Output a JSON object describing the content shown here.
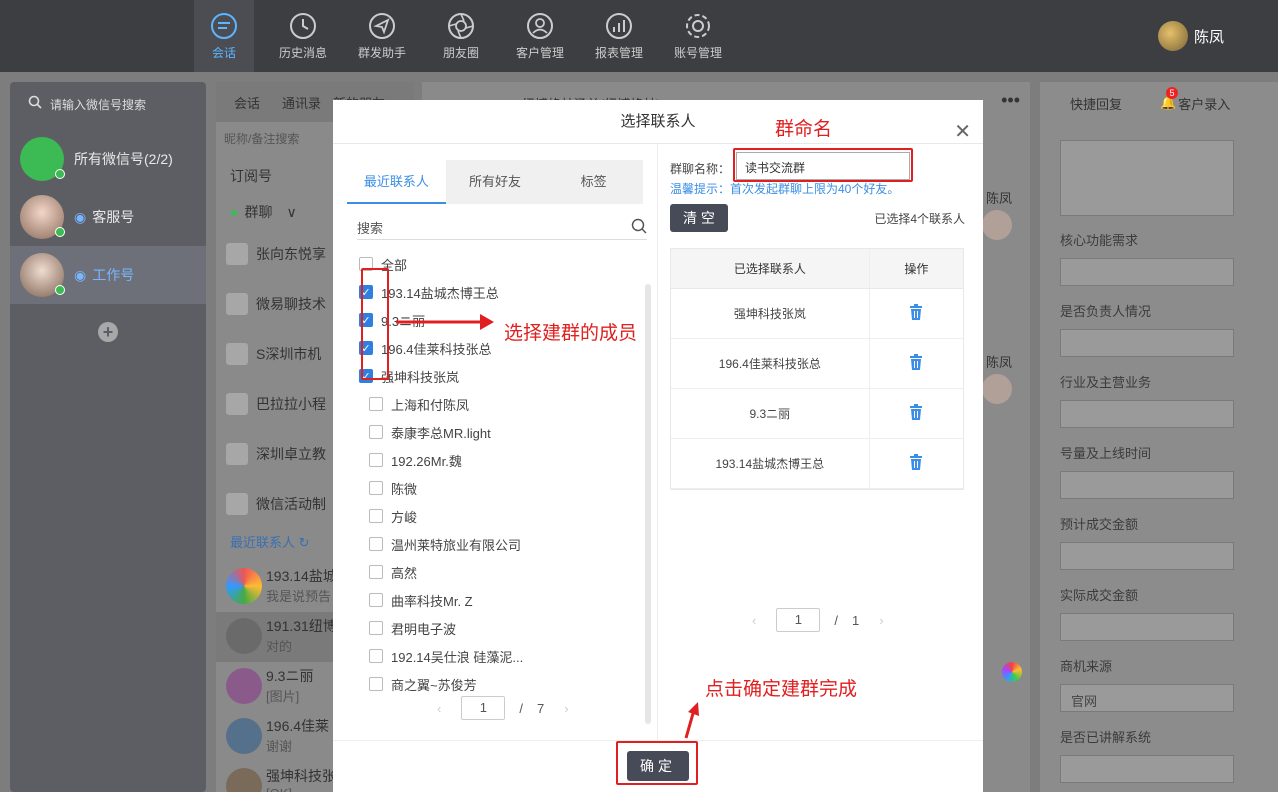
{
  "topnav": [
    {
      "label": "会话",
      "icon": "chat-icon",
      "active": true
    },
    {
      "label": "历史消息",
      "icon": "clock-icon"
    },
    {
      "label": "群发助手",
      "icon": "send-icon"
    },
    {
      "label": "朋友圈",
      "icon": "aperture-icon"
    },
    {
      "label": "客户管理",
      "icon": "person-icon"
    },
    {
      "label": "报表管理",
      "icon": "chart-icon"
    },
    {
      "label": "账号管理",
      "icon": "gear-icon"
    }
  ],
  "user": {
    "name": "陈凤"
  },
  "sidebar": {
    "search_placeholder": "请输入微信号搜索",
    "accounts": [
      {
        "label": "所有微信号(2/2)"
      },
      {
        "label": "客服号"
      },
      {
        "label": "工作号"
      }
    ]
  },
  "middle": {
    "tab_conv": "会话",
    "tab_contacts": "通讯录",
    "tab_new": "新的朋友",
    "search_placeholder": "昵称/备注搜索",
    "subscriptions": "订阅号",
    "groups_header": "群聊",
    "groups": [
      "张向东悦享",
      "微易聊技术",
      "S深圳市机",
      "巴拉拉小程",
      "深圳卓立教",
      "微信活动制"
    ],
    "recent_header": "最近联系人",
    "recent": [
      {
        "name": "193.14盐城",
        "preview": "我是说预告"
      },
      {
        "name": "191.31纽博",
        "preview": "对的"
      },
      {
        "name": "9.3ニ丽",
        "preview": "[图片]"
      },
      {
        "name": "196.4佳莱",
        "preview": "谢谢"
      },
      {
        "name": "强坤科技张",
        "preview": "[OK]"
      }
    ]
  },
  "conversation": {
    "title": "191.31纽博格林汤单(纽博格林)",
    "names": [
      "陈凤",
      "陈凤"
    ]
  },
  "right_panel": {
    "tab_quick": "快捷回复",
    "tab_customer": "客户录入",
    "badge": "5",
    "fields": [
      "核心功能需求",
      "是否负责人情况",
      "行业及主营业务",
      "号量及上线时间",
      "预计成交金额",
      "实际成交金额",
      "商机来源",
      "是否已讲解系统"
    ],
    "source_value": "官网"
  },
  "modal": {
    "title": "选择联系人",
    "tabs": [
      "最近联系人",
      "所有好友",
      "标签"
    ],
    "search_placeholder": "搜索",
    "all_label": "全部",
    "contacts": [
      {
        "name": "193.14盐城杰博王总",
        "checked": true
      },
      {
        "name": "9.3ニ丽",
        "checked": true
      },
      {
        "name": "196.4佳莱科技张总",
        "checked": true
      },
      {
        "name": "强坤科技张岚",
        "checked": true
      },
      {
        "name": "上海和付陈凤",
        "checked": false
      },
      {
        "name": "泰康李总MR.light",
        "checked": false
      },
      {
        "name": "192.26Mr.魏",
        "checked": false
      },
      {
        "name": "陈微",
        "checked": false
      },
      {
        "name": "方峻",
        "checked": false
      },
      {
        "name": "温州莱特旅业有限公司",
        "checked": false
      },
      {
        "name": "高然",
        "checked": false
      },
      {
        "name": "曲率科技Mr. Z",
        "checked": false
      },
      {
        "name": "君明电子波",
        "checked": false
      },
      {
        "name": "192.14吴仕浪 硅藻泥...",
        "checked": false
      },
      {
        "name": "商之翼~苏俊芳",
        "checked": false
      }
    ],
    "left_page": "1",
    "left_total": "7",
    "group_name_label": "群聊名称：",
    "group_name_value": "读书交流群",
    "hint": "温馨提示：首次发起群聊上限为40个好友。",
    "clear_label": "清 空",
    "selected_count": "已选择4个联系人",
    "table_header_name": "已选择联系人",
    "table_header_op": "操作",
    "selected": [
      "强坤科技张岚",
      "196.4佳莱科技张总",
      "9.3ニ丽",
      "193.14盐城杰博王总"
    ],
    "right_page": "1",
    "right_total": "1",
    "ok_label": "确定"
  },
  "annotations": {
    "group_name": "群命名",
    "select_members": "选择建群的成员",
    "click_ok": "点击确定建群完成"
  },
  "colors": {
    "accent": "#3a8ee6",
    "annotation": "#e02020",
    "button": "#474b58"
  }
}
